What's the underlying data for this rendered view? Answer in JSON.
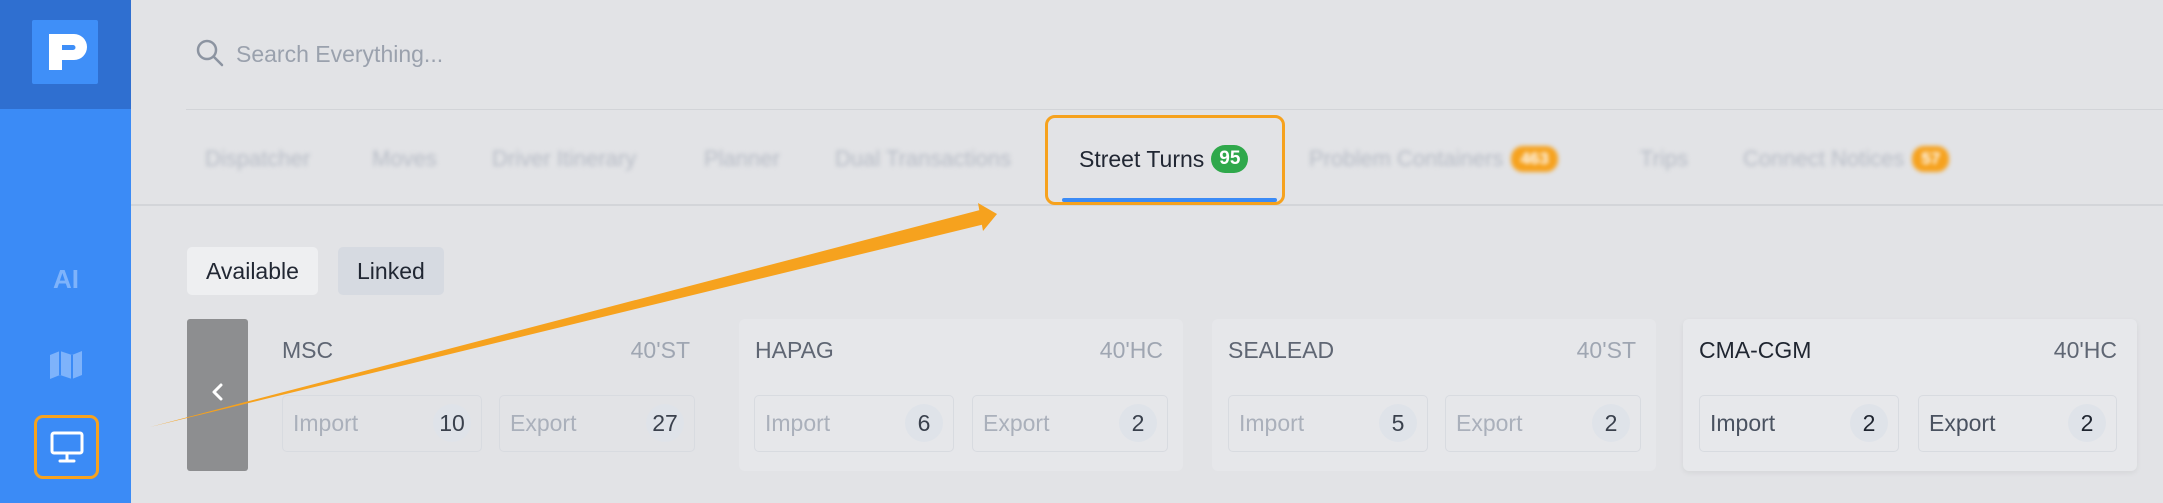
{
  "app": {
    "logo_icon": "p-logo-icon"
  },
  "sidebar": {
    "items": [
      {
        "icon": "ai-icon",
        "label": "AI"
      },
      {
        "icon": "map-icon"
      },
      {
        "icon": "monitor-icon"
      }
    ]
  },
  "search": {
    "placeholder": "Search Everything..."
  },
  "tabs": [
    {
      "label": "Dispatcher"
    },
    {
      "label": "Moves"
    },
    {
      "label": "Driver Itinerary"
    },
    {
      "label": "Planner"
    },
    {
      "label": "Dual Transactions"
    },
    {
      "label": "Street Turns",
      "badge": "95",
      "active": true
    },
    {
      "label": "Problem Containers",
      "badge": "463"
    },
    {
      "label": "Trips"
    },
    {
      "label": "Connect Notices",
      "badge": "57"
    }
  ],
  "filters": {
    "available": "Available",
    "linked": "Linked"
  },
  "cards": [
    {
      "carrier": "MSC",
      "size": "40'ST",
      "import_label": "Import",
      "import_count": "10",
      "export_label": "Export",
      "export_count": "27"
    },
    {
      "carrier": "HAPAG",
      "size": "40'HC",
      "import_label": "Import",
      "import_count": "6",
      "export_label": "Export",
      "export_count": "2"
    },
    {
      "carrier": "SEALEAD",
      "size": "40'ST",
      "import_label": "Import",
      "import_count": "5",
      "export_label": "Export",
      "export_count": "2"
    },
    {
      "carrier": "CMA-CGM",
      "size": "40'HC",
      "import_label": "Import",
      "import_count": "2",
      "export_label": "Export",
      "export_count": "2"
    }
  ],
  "colors": {
    "sidebar": "#3b8bf6",
    "highlight": "#f6a21e",
    "badge_green": "#2fa84b"
  }
}
